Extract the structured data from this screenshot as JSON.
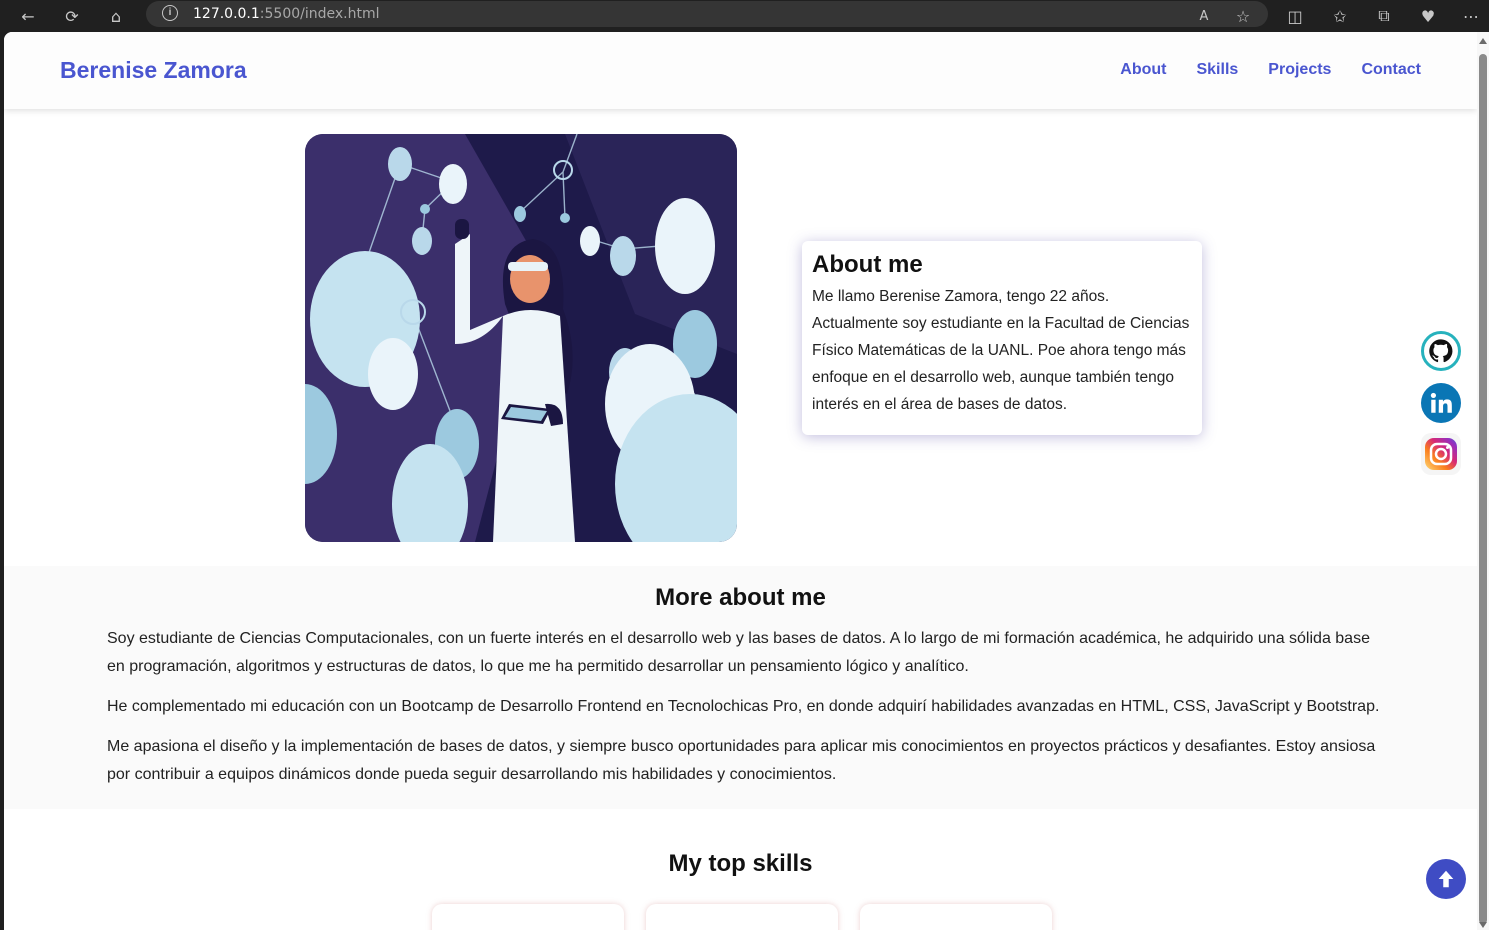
{
  "browser": {
    "url_host": "127.0.0.1",
    "url_rest": ":5500/index.html"
  },
  "header": {
    "brand": "Berenise Zamora",
    "nav": [
      "About",
      "Skills",
      "Projects",
      "Contact"
    ]
  },
  "about": {
    "title": "About me",
    "text": "Me llamo Berenise Zamora, tengo 22 años. Actualmente soy estudiante en la Facultad de Ciencias Físico Matemáticas de la UANL. Poe ahora tengo más enfoque en el desarrollo web, aunque también tengo interés en el área de bases de datos."
  },
  "more": {
    "title": "More about me",
    "paragraphs": [
      "Soy estudiante de Ciencias Computacionales, con un fuerte interés en el desarrollo web y las bases de datos. A lo largo de mi formación académica, he adquirido una sólida base en programación, algoritmos y estructuras de datos, lo que me ha permitido desarrollar un pensamiento lógico y analítico.",
      "He complementado mi educación con un Bootcamp de Desarrollo Frontend en Tecnolochicas Pro, en donde adquirí habilidades avanzadas en HTML, CSS, JavaScript y Bootstrap.",
      "Me apasiona el diseño y la implementación de bases de datos, y siempre busco oportunidades para aplicar mis conocimientos en proyectos prácticos y desafiantes. Estoy ansiosa por contribuir a equipos dinámicos donde pueda seguir desarrollando mis habilidades y conocimientos."
    ]
  },
  "skills": {
    "title": "My top skills"
  },
  "colors": {
    "accent": "#4a56d0",
    "to_top": "#3f4cc4"
  },
  "icons": [
    "back-icon",
    "reload-icon",
    "home-icon",
    "info-icon",
    "read-aloud-icon",
    "favorite-icon",
    "split-screen-icon",
    "favorites-icon",
    "collections-icon",
    "health-icon",
    "more-icon",
    "github-icon",
    "linkedin-icon",
    "instagram-icon",
    "arrow-up-icon"
  ]
}
